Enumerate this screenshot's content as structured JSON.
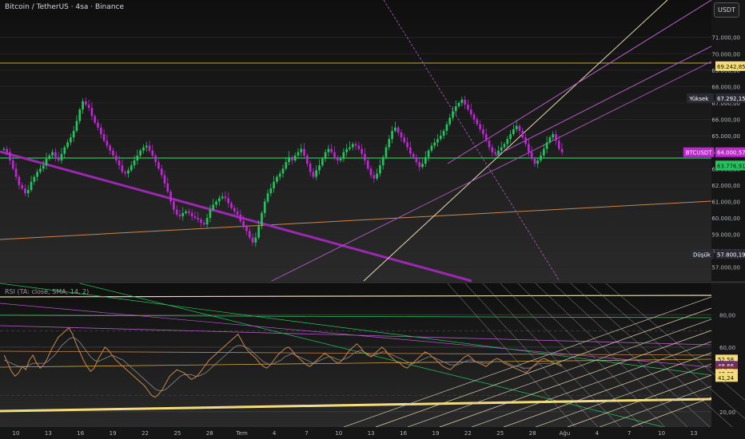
{
  "header": {
    "symbol_title": "Bitcoin / TetherUS · 4sa · Binance",
    "currency_button": "USDT"
  },
  "rsi_header": {
    "label": "RSI (TA: close, SMA, 14, 2)"
  },
  "colors": {
    "background": "#161616",
    "bull_candle": "#22c55e",
    "bear_candle": "#c026d3",
    "rsi_line": "#c8874a",
    "rsi_ma": "#8a8a8a",
    "horizontal_support": "#22c55e",
    "resistance_line": "#d4a43a"
  },
  "chart_data": [
    {
      "type": "candlestick",
      "title": "Bitcoin / TetherUS · 4sa · Binance",
      "ylim": [
        56500,
        72200
      ],
      "y_ticks": [
        "71.000,00",
        "70.000,00",
        "69.000,00",
        "68.000,00",
        "67.000,00",
        "66.000,00",
        "65.000,00",
        "64.000,00",
        "63.000,00",
        "62.000,00",
        "61.000,00",
        "60.000,00",
        "59.000,00",
        "58.000,00",
        "57.000,00"
      ],
      "x_ticks": [
        "10",
        "13",
        "16",
        "19",
        "22",
        "25",
        "28",
        "Tem",
        "4",
        "7",
        "10",
        "13",
        "16",
        "19",
        "22",
        "25",
        "28",
        "Ağu",
        "4",
        "7",
        "10",
        "13"
      ],
      "price_labels": [
        {
          "name": "resistance",
          "text": "69.242,85",
          "color": "#f5dc7a"
        },
        {
          "name": "high",
          "prefix": "Yüksek",
          "text": "67.292,15",
          "color": "#2a2a34"
        },
        {
          "name": "last",
          "prefix": "BTCUSDT",
          "text": "64.000,57",
          "color": "#c026d3"
        },
        {
          "name": "support",
          "text": "63.776,91",
          "color": "#22c55e"
        },
        {
          "name": "low",
          "prefix": "Düşük",
          "text": "57.800,19",
          "color": "#2a2a34"
        }
      ],
      "series": [
        {
          "name": "BTCUSDT",
          "values": [
            64200,
            64000,
            63500,
            63000,
            62500,
            62000,
            61800,
            61500,
            61700,
            62200,
            62500,
            62800,
            63000,
            63200,
            63600,
            63800,
            64000,
            63700,
            63500,
            63900,
            64300,
            64600,
            64900,
            65300,
            65900,
            66600,
            67100,
            66900,
            66700,
            66200,
            65800,
            65500,
            65100,
            64700,
            64400,
            64100,
            63800,
            63500,
            63200,
            62800,
            62700,
            62900,
            63200,
            63500,
            63800,
            64100,
            64300,
            64400,
            64100,
            63800,
            63400,
            63000,
            62600,
            62100,
            61600,
            61000,
            60500,
            60200,
            60100,
            60300,
            60400,
            60300,
            60100,
            60000,
            59900,
            59700,
            59600,
            60000,
            60500,
            60800,
            61000,
            61200,
            61300,
            61200,
            60900,
            60600,
            60400,
            60200,
            59800,
            59500,
            59200,
            58800,
            58500,
            58800,
            59500,
            60300,
            61000,
            61500,
            61800,
            62200,
            62500,
            62700,
            63000,
            63400,
            63700,
            63500,
            63800,
            64000,
            64200,
            63800,
            63300,
            62800,
            62500,
            62900,
            63200,
            63600,
            64000,
            64200,
            64000,
            63700,
            63500,
            63600,
            64000,
            64200,
            64300,
            64500,
            64400,
            64200,
            63900,
            63500,
            63000,
            62600,
            62400,
            62700,
            63200,
            63700,
            64300,
            64800,
            65300,
            65500,
            65200,
            64900,
            64600,
            64300,
            63900,
            63700,
            63400,
            63100,
            63300,
            63700,
            64100,
            64400,
            64600,
            64800,
            65000,
            65300,
            65700,
            66100,
            66500,
            66800,
            67000,
            67200,
            66900,
            66600,
            66300,
            66000,
            65700,
            65400,
            65100,
            64700,
            64300,
            64000,
            63900,
            64100,
            64300,
            64500,
            64800,
            65100,
            65400,
            65600,
            65300,
            64900,
            64500,
            64000,
            63600,
            63300,
            63500,
            63800,
            64200,
            64600,
            64900,
            65100,
            64700,
            64200,
            64000
          ]
        }
      ]
    },
    {
      "type": "line",
      "title": "RSI (TA: close, SMA, 14, 2)",
      "ylim": [
        12,
        96
      ],
      "y_ticks": [
        "80,00",
        "60,00",
        "20,00"
      ],
      "value_labels": [
        {
          "text": "52,58",
          "color": "#f5dc7a"
        },
        {
          "text": "48,66",
          "color": "#6b2e6b"
        },
        {
          "text": "45,51",
          "color": "#7a2f2f"
        },
        {
          "text": "43,69",
          "color": "#f5dc7a"
        },
        {
          "text": "41,24",
          "color": "#f5dc7a"
        }
      ],
      "series": [
        {
          "name": "RSI",
          "values": [
            55,
            50,
            45,
            42,
            44,
            48,
            46,
            52,
            55,
            50,
            47,
            49,
            53,
            58,
            62,
            66,
            68,
            70,
            72,
            68,
            62,
            57,
            52,
            48,
            45,
            47,
            52,
            56,
            60,
            58,
            55,
            52,
            50,
            48,
            46,
            44,
            42,
            40,
            38,
            36,
            33,
            30,
            29,
            31,
            34,
            38,
            42,
            44,
            46,
            45,
            44,
            42,
            40,
            41,
            43,
            46,
            49,
            52,
            54,
            56,
            58,
            60,
            62,
            64,
            66,
            68,
            64,
            60,
            57,
            55,
            53,
            50,
            48,
            47,
            49,
            52,
            55,
            57,
            59,
            60,
            58,
            55,
            53,
            51,
            49,
            48,
            50,
            52,
            54,
            56,
            55,
            53,
            51,
            50,
            52,
            55,
            58,
            60,
            62,
            60,
            57,
            55,
            54,
            56,
            58,
            60,
            58,
            55,
            53,
            51,
            50,
            48,
            47,
            49,
            51,
            53,
            55,
            57,
            56,
            54,
            52,
            50,
            48,
            47,
            46,
            48,
            50,
            52,
            54,
            55,
            53,
            51,
            50,
            49,
            48,
            50,
            52,
            53,
            52,
            50,
            49,
            48,
            47,
            46,
            45,
            44,
            46,
            48,
            50,
            52,
            53,
            52,
            51,
            50,
            49,
            48
          ]
        },
        {
          "name": "RSI-MA",
          "values": [
            52,
            51,
            50,
            49,
            48,
            48,
            48,
            49,
            50,
            50,
            50,
            50,
            51,
            53,
            55,
            58,
            61,
            63,
            65,
            66,
            65,
            63,
            60,
            57,
            54,
            52,
            51,
            52,
            53,
            54,
            55,
            54,
            53,
            52,
            50,
            48,
            46,
            44,
            42,
            40,
            38,
            36,
            34,
            33,
            33,
            34,
            36,
            38,
            40,
            42,
            43,
            43,
            43,
            42,
            42,
            43,
            44,
            46,
            48,
            50,
            52,
            54,
            56,
            58,
            60,
            61,
            61,
            60,
            59,
            57,
            55,
            53,
            51,
            50,
            49,
            50,
            51,
            52,
            54,
            55,
            56,
            55,
            54,
            53,
            52,
            51,
            50,
            51,
            52,
            53,
            54,
            54,
            53,
            52,
            52,
            53,
            54,
            56,
            57,
            58,
            57,
            56,
            55,
            55,
            56,
            57,
            57,
            56,
            55,
            54,
            53,
            52,
            51,
            50,
            50,
            51,
            52,
            53,
            54,
            54,
            53,
            52,
            51,
            50,
            49,
            49,
            49,
            50,
            51,
            52,
            52,
            51,
            51,
            50,
            50,
            50,
            51,
            51,
            51,
            51,
            50,
            49,
            48,
            48,
            47,
            47,
            47,
            48,
            49,
            50,
            50,
            50,
            50,
            50,
            50,
            49
          ]
        }
      ]
    }
  ]
}
